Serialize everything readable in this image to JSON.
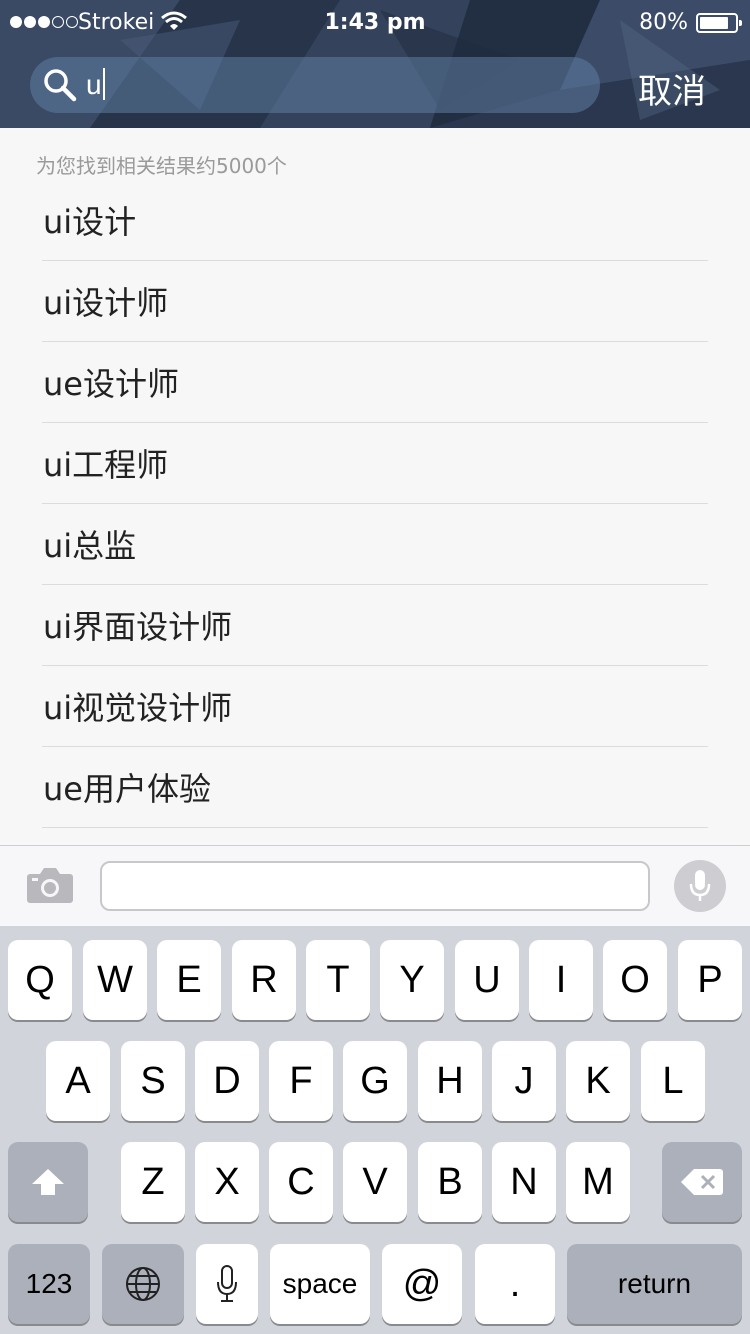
{
  "status_bar": {
    "carrier": "Strokei",
    "time": "1:43 pm",
    "battery": "80%",
    "battery_level": 0.8,
    "signal_bars": 3,
    "signal_total": 5
  },
  "search": {
    "query": "u",
    "cancel_label": "取消"
  },
  "results": {
    "count_text": "为您找到相关结果约5000个",
    "items": [
      "ui设计",
      "ui设计师",
      "ue设计师",
      "ui工程师",
      "ui总监",
      "ui界面设计师",
      "ui视觉设计师",
      "ue用户体验"
    ]
  },
  "accessory": {
    "message_value": ""
  },
  "keyboard": {
    "row1": [
      "Q",
      "W",
      "E",
      "R",
      "T",
      "Y",
      "U",
      "I",
      "O",
      "P"
    ],
    "row2": [
      "A",
      "S",
      "D",
      "F",
      "G",
      "H",
      "J",
      "K",
      "L"
    ],
    "row3": [
      "Z",
      "X",
      "C",
      "V",
      "B",
      "N",
      "M"
    ],
    "numbers_label": "123",
    "space_label": "space",
    "at_label": "@",
    "dot_label": ".",
    "return_label": "return"
  },
  "icons": {
    "search": "search-icon",
    "camera": "camera-icon",
    "microphone": "microphone-icon",
    "globe": "globe-icon",
    "shift": "shift-icon",
    "delete": "delete-icon",
    "wifi": "wifi-icon",
    "battery": "battery-icon"
  },
  "colors": {
    "header_bg": "#2f3d55",
    "search_field": "#5f7da0",
    "keyboard_bg": "#d1d5db",
    "key_dark": "#abb0ba",
    "text": "#222222",
    "muted": "#9a9a9a"
  }
}
